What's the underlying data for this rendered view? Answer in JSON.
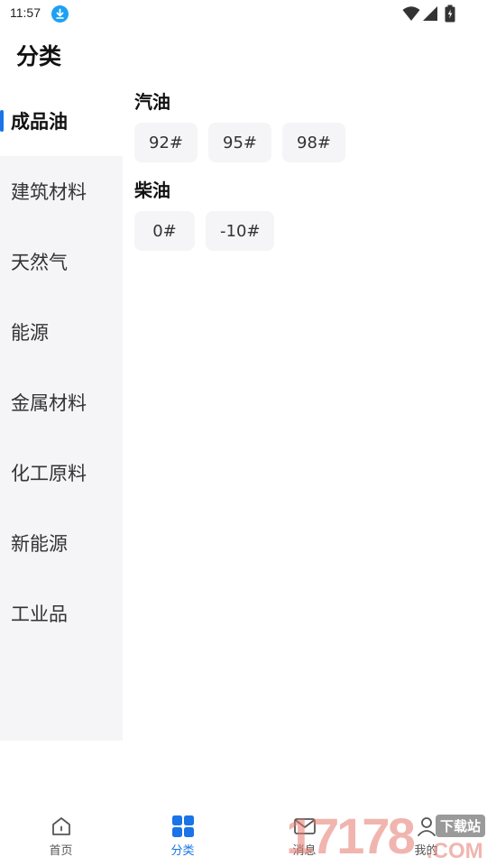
{
  "status_bar": {
    "time": "11:57",
    "icons": [
      "download-icon",
      "wifi-icon",
      "signal-icon",
      "battery-icon"
    ]
  },
  "page": {
    "title": "分类"
  },
  "sidebar": {
    "items": [
      {
        "label": "成品油",
        "active": true
      },
      {
        "label": "建筑材料",
        "active": false
      },
      {
        "label": "天然气",
        "active": false
      },
      {
        "label": "能源",
        "active": false
      },
      {
        "label": "金属材料",
        "active": false
      },
      {
        "label": "化工原料",
        "active": false
      },
      {
        "label": "新能源",
        "active": false
      },
      {
        "label": "工业品",
        "active": false
      }
    ]
  },
  "content": {
    "groups": [
      {
        "title": "汽油",
        "chips": [
          "92#",
          "95#",
          "98#"
        ]
      },
      {
        "title": "柴油",
        "chips": [
          "0#",
          "-10#"
        ]
      }
    ]
  },
  "bottom_nav": {
    "items": [
      {
        "label": "首页",
        "icon": "home-icon",
        "active": false
      },
      {
        "label": "分类",
        "icon": "grid-icon",
        "active": true
      },
      {
        "label": "消息",
        "icon": "message-icon",
        "active": false
      },
      {
        "label": "我的",
        "icon": "user-icon",
        "active": false
      }
    ]
  },
  "watermark": {
    "site_number": "17178",
    "site_suffix": ".COM",
    "badge_text": "下载站"
  },
  "colors": {
    "accent": "#1a73e8",
    "sidebar_bg": "#f5f5f7",
    "chip_bg": "#f5f5f7",
    "download_badge": "#1da1f2"
  }
}
